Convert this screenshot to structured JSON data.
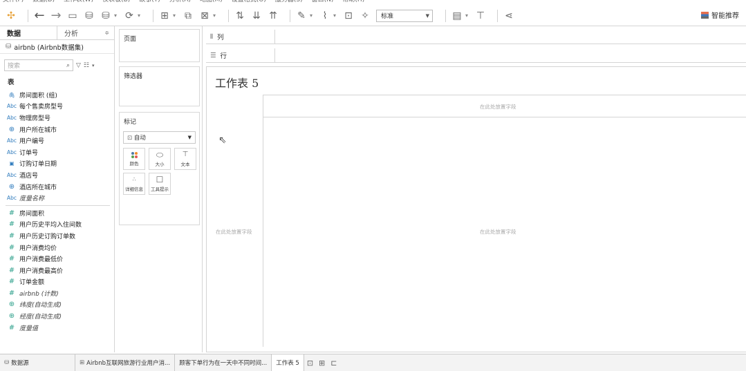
{
  "menu": [
    "文件(F)",
    "数据(D)",
    "工作表(W)",
    "仪表板(B)",
    "故事(T)",
    "分析(A)",
    "地图(M)",
    "设置格式(O)",
    "服务器(S)",
    "窗口(N)",
    "帮助(H)"
  ],
  "toolbar": {
    "fit_label": "标准",
    "smart_label": "智能推荐"
  },
  "data_pane": {
    "tab_data": "数据",
    "tab_analysis": "分析",
    "datasource": "airbnb (Airbnb数据集)",
    "search_placeholder": "搜索",
    "table_label": "表",
    "dimensions": [
      {
        "icon": "paperclip-icon",
        "glyph": "🖇",
        "name": "房间面积 (组)"
      },
      {
        "icon": "abc-icon",
        "glyph": "Abc",
        "name": "每个售卖房型号"
      },
      {
        "icon": "abc-icon",
        "glyph": "Abc",
        "name": "物理房型号"
      },
      {
        "icon": "globe-icon",
        "glyph": "⊕",
        "name": "用户所在城市"
      },
      {
        "icon": "abc-icon",
        "glyph": "Abc",
        "name": "用户编号"
      },
      {
        "icon": "abc-icon",
        "glyph": "Abc",
        "name": "订单号"
      },
      {
        "icon": "calendar-icon",
        "glyph": "▣",
        "name": "订购订单日期"
      },
      {
        "icon": "abc-icon",
        "glyph": "Abc",
        "name": "酒店号"
      },
      {
        "icon": "globe-icon",
        "glyph": "⊕",
        "name": "酒店所在城市"
      },
      {
        "icon": "abc-icon",
        "glyph": "Abc",
        "name": "度量名称",
        "italic": true
      }
    ],
    "measures": [
      {
        "name": "房间面积"
      },
      {
        "name": "用户历史平均入住间数"
      },
      {
        "name": "用户历史订购订单数"
      },
      {
        "name": "用户消费均价"
      },
      {
        "name": "用户消费最低价"
      },
      {
        "name": "用户消费最高价"
      },
      {
        "name": "订单金额"
      },
      {
        "name": "airbnb (计数)",
        "italic": true
      },
      {
        "name": "纬度(自动生成)",
        "italic": true,
        "geo": true
      },
      {
        "name": "经度(自动生成)",
        "italic": true,
        "geo": true
      },
      {
        "name": "度量值",
        "italic": true
      }
    ]
  },
  "shelves": {
    "pages": "页面",
    "filters": "筛选器",
    "marks": "标记",
    "marks_type": "自动",
    "mark_buttons": [
      "颜色",
      "大小",
      "文本",
      "详细信息",
      "工具提示"
    ],
    "columns": "列",
    "rows": "行"
  },
  "colors": {
    "dot1": "#4e79a7",
    "dot2": "#f28e2b",
    "dot3": "#59a14f",
    "dot4": "#e15759"
  },
  "sheet": {
    "title": "工作表 5",
    "drop_col": "在此处放置字段",
    "drop_row": "在此处放置字段",
    "drop_center": "在此处放置字段"
  },
  "tabs": {
    "datasource": "数据源",
    "sheets": [
      "Airbnb互联网旅游行业用户消...",
      "顾客下单行为在一天中不同时间...",
      "工作表 5"
    ]
  }
}
